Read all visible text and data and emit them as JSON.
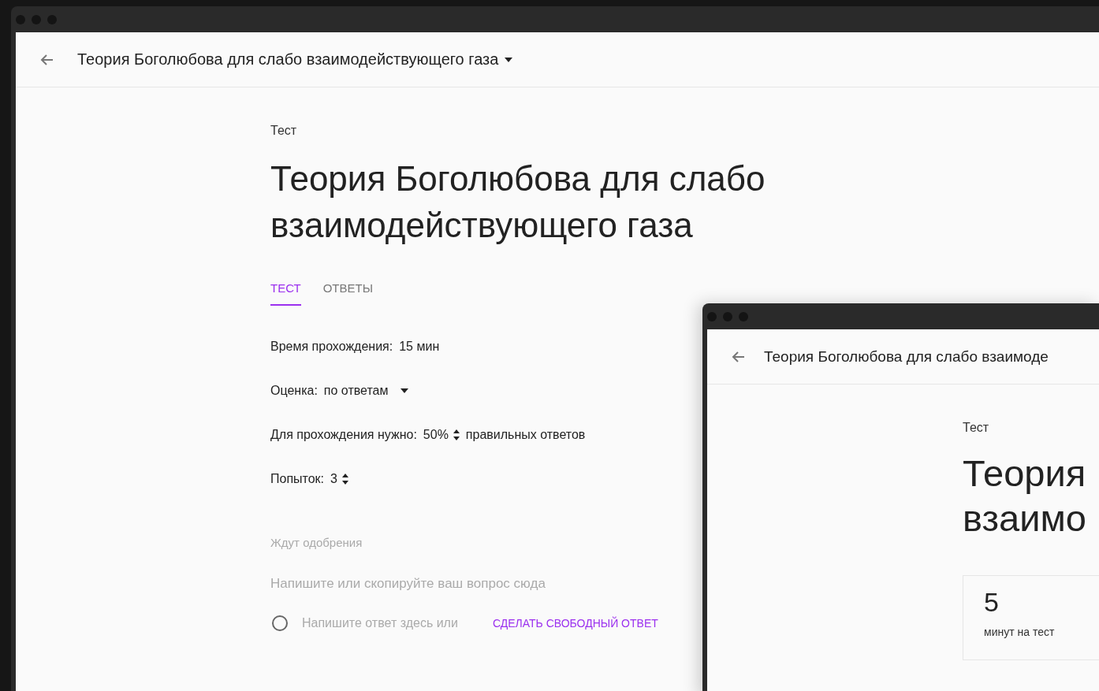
{
  "main_window": {
    "header": {
      "title": "Теория Боголюбова для слабо взаимодействующего газа"
    },
    "label": "Тест",
    "title": "Теория Боголюбова для слабо взаимодействующего газа",
    "tabs": [
      {
        "label": "ТЕСТ",
        "selected": true
      },
      {
        "label": "ОТВЕТЫ",
        "selected": false
      }
    ],
    "settings": [
      {
        "kind": "text",
        "label": "Время прохождения:",
        "value": "15 мин"
      },
      {
        "kind": "dropdown",
        "label": "Оценка:",
        "value": "по ответам"
      },
      {
        "kind": "stepper",
        "label": "Для прохождения нужно:",
        "value": "50%",
        "suffix": "правильных ответов"
      },
      {
        "kind": "stepper",
        "label": "Попыток:",
        "value": "3"
      }
    ],
    "section_label": "Ждут одобрения",
    "question": {
      "placeholder": "Напишите или скопируйте ваш вопрос сюда"
    },
    "answer": {
      "checked": false,
      "placeholder": "Напишите ответ здесь или",
      "link": "СДЕЛАТЬ СВОБОДНЫЙ ОТВЕТ"
    }
  },
  "preview_window": {
    "header": {
      "title": "Теория Боголюбова для слабо взаимоде"
    },
    "label": "Тест",
    "title_lines": [
      "Теория",
      "взаимо"
    ],
    "stat": {
      "value": "5",
      "caption": "минут на тест"
    }
  }
}
